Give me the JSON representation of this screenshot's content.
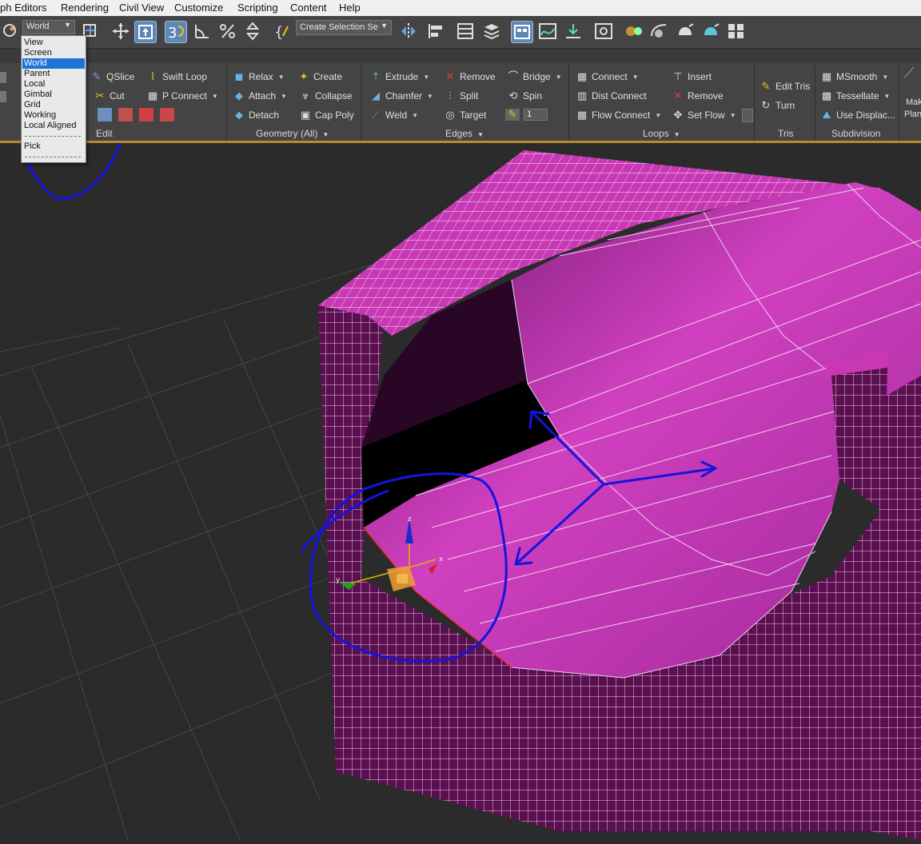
{
  "menubar": {
    "items": [
      "ph Editors",
      "Rendering",
      "Civil View",
      "Customize",
      "Scripting",
      "Content",
      "Help"
    ]
  },
  "main_toolbar": {
    "reference_coord_value": "World",
    "named_selection_set_placeholder": "Create Selection Se",
    "icons": [
      "snap-toggle-icon",
      "percent-snap-icon",
      "angle-snap-icon",
      "mirror-icon",
      "align-icon",
      "layer-explorer-icon",
      "ribbon-toggle-icon",
      "curve-editor-icon",
      "schematic-view-icon",
      "material-editor-icon",
      "render-setup-icon",
      "render-frame-icon",
      "render-icon"
    ]
  },
  "reference_dropdown": {
    "options": [
      "View",
      "Screen",
      "World",
      "Parent",
      "Local",
      "Gimbal",
      "Grid",
      "Working",
      "Local Aligned",
      "Pick"
    ],
    "selected": "World"
  },
  "ribbon": {
    "edit": {
      "title": "Edit",
      "items": [
        "QSlice",
        "Swift Loop",
        "Cut",
        "P Connect"
      ]
    },
    "geometry": {
      "title": "Geometry (All)",
      "items": [
        "Relax",
        "Create",
        "Attach",
        "Collapse",
        "Detach",
        "Cap Poly"
      ]
    },
    "edges": {
      "title": "Edges",
      "items": [
        "Extrude",
        "Remove",
        "Bridge",
        "Chamfer",
        "Split",
        "Spin",
        "Weld",
        "Target"
      ],
      "spinner_value": "1"
    },
    "loops": {
      "title": "Loops",
      "items": [
        "Connect",
        "Insert",
        "Dist Connect",
        "Remove",
        "Flow Connect",
        "Set Flow"
      ]
    },
    "tris": {
      "title": "Tris",
      "items": [
        "Edit Tris",
        "Turn"
      ]
    },
    "subdivision": {
      "title": "Subdivision",
      "items": [
        "MSmooth",
        "Tessellate",
        "Use Displac..."
      ]
    },
    "overflow": {
      "items": [
        "Mak",
        "Plan"
      ]
    }
  },
  "viewport": {
    "gizmo_axes": [
      "z",
      "x",
      "y"
    ],
    "colors": {
      "mesh_magenta": "#c838b4",
      "mesh_dark": "#5a1050",
      "annotation_blue": "#1010e0",
      "grid": "#4a4a4a",
      "background": "#2b2b2b"
    }
  }
}
